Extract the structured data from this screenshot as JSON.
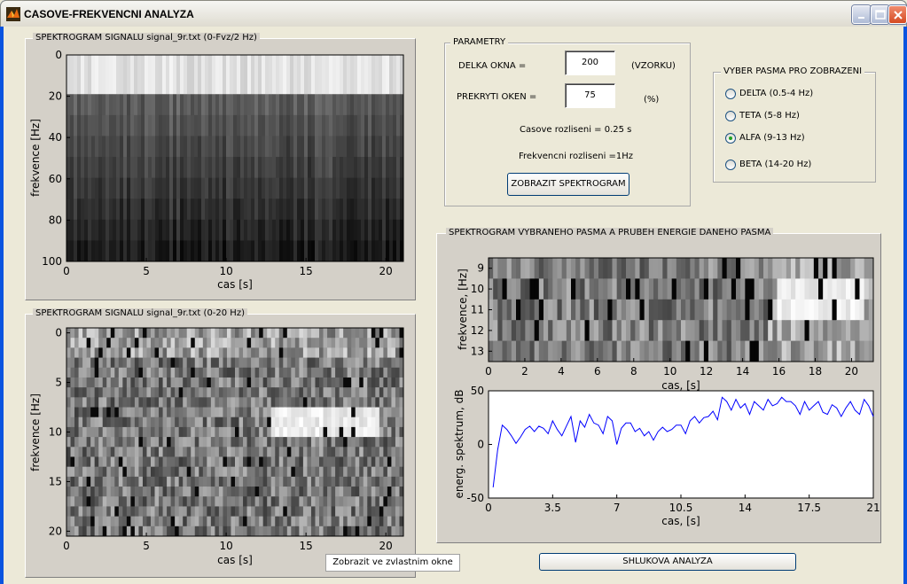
{
  "window": {
    "title": "CASOVE-FREKVENCNI ANALYZA",
    "icon": "matlab-icon",
    "controls": {
      "minimize": "minimize-icon",
      "maximize": "maximize-icon",
      "close": "close-icon"
    }
  },
  "spectrogram_full": {
    "title": "SPEKTROGRAM SIGNALU signal_9r.txt (0-Fvz/2 Hz)",
    "xlabel": "cas [s]",
    "ylabel": "frekvence [Hz]",
    "xticks": [
      "0",
      "5",
      "10",
      "15",
      "20"
    ],
    "yticks": [
      "0",
      "20",
      "40",
      "60",
      "80",
      "100"
    ]
  },
  "spectrogram_low": {
    "title": "SPEKTROGRAM SIGNALU signal_9r.txt (0-20 Hz)",
    "xlabel": "cas [s]",
    "ylabel": "frekvence [Hz]",
    "xticks": [
      "0",
      "5",
      "10",
      "15",
      "20"
    ],
    "yticks": [
      "0",
      "5",
      "10",
      "15",
      "20"
    ]
  },
  "params": {
    "title": "PARAMETRY",
    "window_length_label": "DELKA OKNA =",
    "window_length_value": "200",
    "window_length_unit": "(VZORKU)",
    "overlap_label": "PREKRYTI OKEN  =",
    "overlap_value": "75",
    "overlap_unit": "(%)",
    "time_res": "Casove rozliseni = 0.25 s",
    "freq_res": "Frekvencni rozliseni =1Hz",
    "show_button": "ZOBRAZIT SPEKTROGRAM"
  },
  "bands": {
    "title": "VYBER PASMA PRO ZOBRAZENI",
    "options": [
      {
        "label": "DELTA (0.5-4 Hz)",
        "checked": false
      },
      {
        "label": "TETA (5-8 Hz)",
        "checked": false
      },
      {
        "label": "ALFA (9-13 Hz)",
        "checked": true
      },
      {
        "label": "BETA (14-20 Hz)",
        "checked": false
      }
    ]
  },
  "band_panel": {
    "title": "SPEKTROGRAM VYBRANEHO PASMA  A PRUBEH ENERGIE DANEHO PASMA",
    "spec_xlabel": "cas, [s]",
    "spec_ylabel": "frekvence, [Hz]",
    "spec_xticks": [
      "0",
      "2",
      "4",
      "6",
      "8",
      "10",
      "12",
      "14",
      "16",
      "18",
      "20"
    ],
    "spec_yticks": [
      "9",
      "10",
      "11",
      "12",
      "13"
    ],
    "energy_xlabel": "cas, [s]",
    "energy_ylabel": "energ. spektrum, dB",
    "energy_xticks": [
      "0",
      "3.5",
      "7",
      "10.5",
      "14",
      "17.5",
      "21"
    ],
    "energy_yticks": [
      "50",
      "0",
      "-50"
    ]
  },
  "popup_button": "Zobrazit ve zvlastnim okne",
  "cluster_button": "SHLUKOVA ANALYZA",
  "colors": {
    "line": "#0000ff",
    "panel": "#d4d0c8",
    "window_bg": "#ece9d8"
  },
  "chart_data": {
    "type": "line",
    "xlabel": "cas, [s]",
    "ylabel": "energ. spektrum, dB",
    "xlim": [
      0,
      21
    ],
    "ylim": [
      -50,
      50
    ],
    "x": [
      0.25,
      0.5,
      0.75,
      1,
      1.25,
      1.5,
      1.75,
      2,
      2.25,
      2.5,
      2.75,
      3,
      3.25,
      3.5,
      3.75,
      4,
      4.25,
      4.5,
      4.75,
      5,
      5.25,
      5.5,
      5.75,
      6,
      6.25,
      6.5,
      6.75,
      7,
      7.25,
      7.5,
      7.75,
      8,
      8.25,
      8.5,
      8.75,
      9,
      9.25,
      9.5,
      9.75,
      10,
      10.25,
      10.5,
      10.75,
      11,
      11.25,
      11.5,
      11.75,
      12,
      12.25,
      12.5,
      12.75,
      13,
      13.25,
      13.5,
      13.75,
      14,
      14.25,
      14.5,
      14.75,
      15,
      15.25,
      15.5,
      15.75,
      16,
      16.25,
      16.5,
      16.75,
      17,
      17.25,
      17.5,
      17.75,
      18,
      18.25,
      18.5,
      18.75,
      19,
      19.25,
      19.5,
      19.75,
      20,
      20.25,
      20.5,
      20.75,
      21
    ],
    "values": [
      -40,
      -5,
      18,
      14,
      8,
      1,
      7,
      14,
      17,
      12,
      17,
      15,
      10,
      22,
      14,
      8,
      17,
      26,
      2,
      22,
      16,
      28,
      20,
      18,
      10,
      26,
      22,
      0,
      15,
      20,
      20,
      12,
      15,
      8,
      12,
      4,
      12,
      16,
      12,
      14,
      18,
      18,
      10,
      22,
      26,
      20,
      25,
      26,
      31,
      23,
      44,
      40,
      32,
      42,
      34,
      38,
      28,
      40,
      36,
      32,
      42,
      36,
      38,
      44,
      40,
      40,
      36,
      28,
      40,
      32,
      36,
      40,
      30,
      28,
      37,
      34,
      26,
      34,
      40,
      32,
      28,
      42,
      36,
      26
    ],
    "series": [
      {
        "name": "",
        "color": "#0000ff"
      }
    ]
  }
}
